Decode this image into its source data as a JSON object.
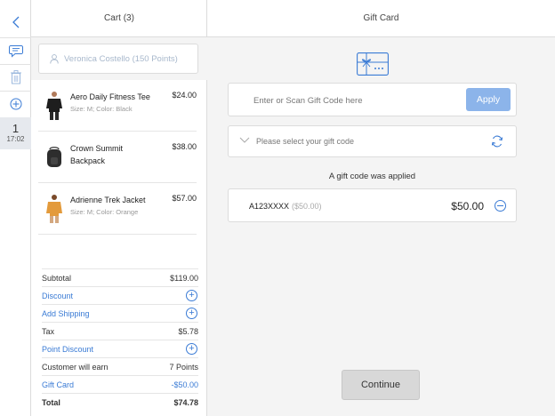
{
  "rail": {
    "order_number": "1",
    "order_time": "17:02"
  },
  "cart": {
    "title": "Cart (3)",
    "customer": "Veronica Costello  (150 Points)",
    "items": [
      {
        "name": "Aero Daily Fitness Tee",
        "meta": "Size: M; Color: Black",
        "price": "$24.00"
      },
      {
        "name": "Crown Summit Backpack",
        "meta": "",
        "price": "$38.00"
      },
      {
        "name": "Adrienne Trek Jacket",
        "meta": "Size: M; Color: Orange",
        "price": "$57.00"
      }
    ],
    "totals": {
      "subtotal_label": "Subtotal",
      "subtotal_value": "$119.00",
      "discount_label": "Discount",
      "shipping_label": "Add Shipping",
      "tax_label": "Tax",
      "tax_value": "$5.78",
      "point_discount_label": "Point Discount",
      "earn_label": "Customer will earn",
      "earn_value": "7 Points",
      "giftcard_label": "Gift Card",
      "giftcard_value": "-$50.00",
      "total_label": "Total",
      "total_value": "$74.78"
    }
  },
  "gift": {
    "title": "Gift Card",
    "code_placeholder": "Enter or Scan Gift Code here",
    "apply_label": "Apply",
    "select_placeholder": "Please select your gift code",
    "applied_message": "A gift code was applied",
    "applied_code": "A123XXXX",
    "applied_code_sub": "($50.00)",
    "applied_amount": "$50.00",
    "continue_label": "Continue"
  },
  "colors": {
    "accent": "#3a7bd5",
    "apply_button": "#8cb4ea",
    "panel_bg": "#f4f4f4"
  },
  "icons": {
    "back": "chevron-left-icon",
    "comment": "comment-icon",
    "trash": "trash-icon",
    "add": "plus-circle-icon",
    "customer": "user-icon",
    "gift": "gift-card-icon",
    "dropdown": "chevron-down-icon",
    "refresh": "refresh-icon",
    "remove": "minus-circle-icon"
  }
}
